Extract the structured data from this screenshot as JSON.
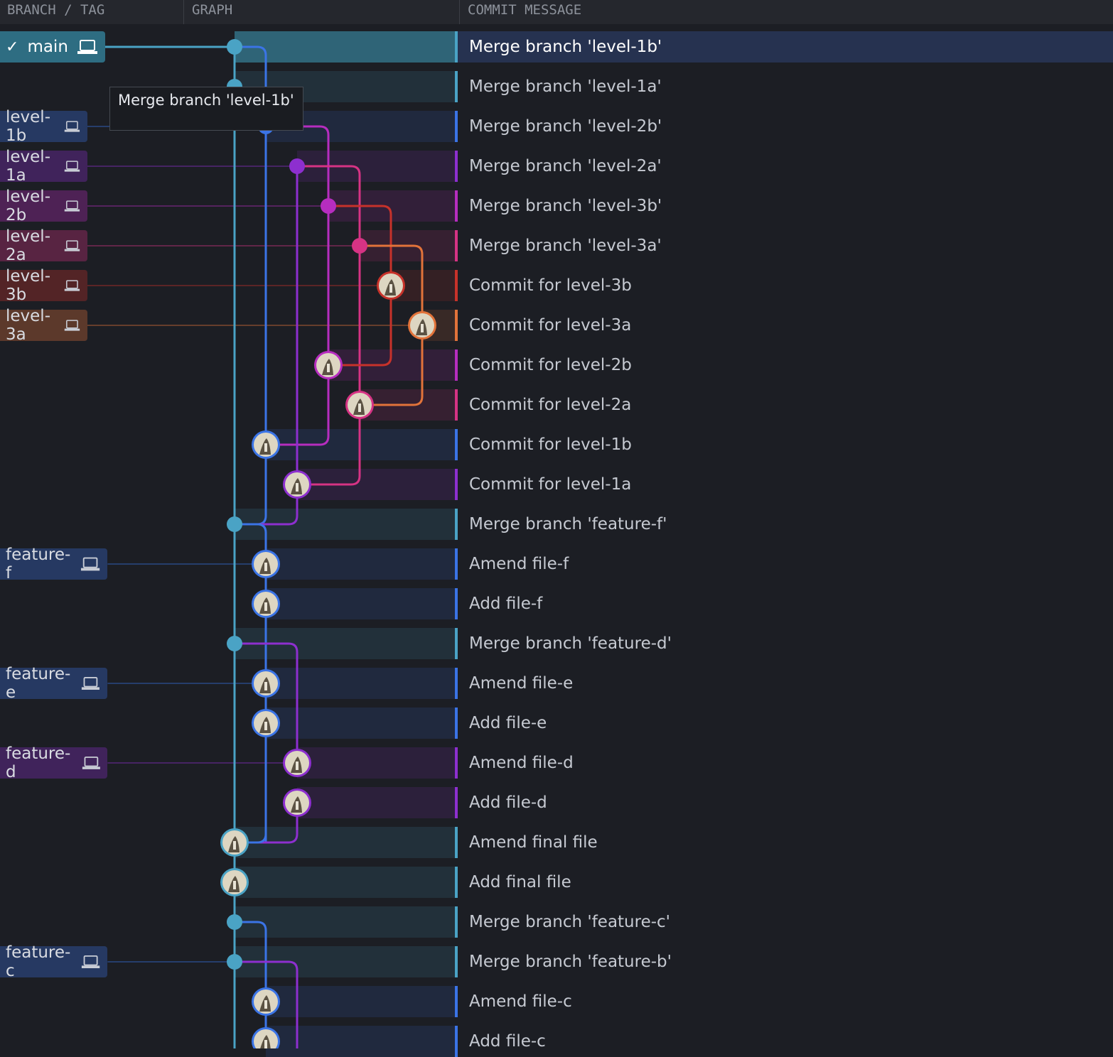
{
  "header": {
    "branch_tag": "BRANCH / TAG",
    "graph": "GRAPH",
    "commit_message": "COMMIT MESSAGE"
  },
  "tooltip": "Merge branch 'level-1b'",
  "colors": {
    "main": "#4aa3c5",
    "blue": "#3b74e6",
    "purple": "#8d2fcf",
    "magenta": "#b62dbf",
    "pink": "#d63384",
    "red": "#c7322a",
    "orange": "#e2733a"
  },
  "branches": [
    {
      "name": "main",
      "row": 0,
      "current": true,
      "color": "main",
      "icon": "laptop-icon"
    },
    {
      "name": "level-1b",
      "row": 2,
      "color": "blue",
      "icon": "laptop-icon"
    },
    {
      "name": "level-1a",
      "row": 3,
      "color": "purple",
      "icon": "laptop-icon"
    },
    {
      "name": "level-2b",
      "row": 4,
      "color": "magenta",
      "icon": "laptop-icon"
    },
    {
      "name": "level-2a",
      "row": 5,
      "color": "pink",
      "icon": "laptop-icon"
    },
    {
      "name": "level-3b",
      "row": 6,
      "color": "red",
      "icon": "laptop-icon"
    },
    {
      "name": "level-3a",
      "row": 7,
      "color": "orange",
      "icon": "laptop-icon"
    },
    {
      "name": "feature-f",
      "row": 13,
      "color": "blue",
      "icon": "laptop-icon"
    },
    {
      "name": "feature-e",
      "row": 16,
      "color": "blue",
      "icon": "laptop-icon"
    },
    {
      "name": "feature-d",
      "row": 18,
      "color": "purple",
      "icon": "laptop-icon"
    },
    {
      "name": "feature-c",
      "row": 23,
      "color": "blue",
      "icon": "laptop-icon"
    }
  ],
  "commits": [
    {
      "message": "Merge branch 'level-1b'",
      "lane": 0,
      "color": "main",
      "merge": true,
      "selected": true
    },
    {
      "message": "Merge branch 'level-1a'",
      "lane": 0,
      "color": "main",
      "merge": true
    },
    {
      "message": "Merge branch 'level-2b'",
      "lane": 1,
      "color": "blue",
      "merge": true
    },
    {
      "message": "Merge branch 'level-2a'",
      "lane": 2,
      "color": "purple",
      "merge": true
    },
    {
      "message": "Merge branch 'level-3b'",
      "lane": 3,
      "color": "magenta",
      "merge": true
    },
    {
      "message": "Merge branch 'level-3a'",
      "lane": 4,
      "color": "pink",
      "merge": true
    },
    {
      "message": "Commit for level-3b",
      "lane": 5,
      "color": "red",
      "merge": false
    },
    {
      "message": "Commit for level-3a",
      "lane": 6,
      "color": "orange",
      "merge": false
    },
    {
      "message": "Commit for level-2b",
      "lane": 3,
      "color": "magenta",
      "merge": false
    },
    {
      "message": "Commit for level-2a",
      "lane": 4,
      "color": "pink",
      "merge": false
    },
    {
      "message": "Commit for level-1b",
      "lane": 1,
      "color": "blue",
      "merge": false
    },
    {
      "message": "Commit for level-1a",
      "lane": 2,
      "color": "purple",
      "merge": false
    },
    {
      "message": "Merge branch 'feature-f'",
      "lane": 0,
      "color": "main",
      "merge": true
    },
    {
      "message": "Amend file-f",
      "lane": 1,
      "color": "blue",
      "merge": false
    },
    {
      "message": "Add file-f",
      "lane": 1,
      "color": "blue",
      "merge": false
    },
    {
      "message": "Merge branch 'feature-d'",
      "lane": 0,
      "color": "main",
      "merge": true
    },
    {
      "message": "Amend file-e",
      "lane": 1,
      "color": "blue",
      "merge": false
    },
    {
      "message": "Add file-e",
      "lane": 1,
      "color": "blue",
      "merge": false
    },
    {
      "message": "Amend file-d",
      "lane": 2,
      "color": "purple",
      "merge": false
    },
    {
      "message": "Add file-d",
      "lane": 2,
      "color": "purple",
      "merge": false
    },
    {
      "message": "Amend final file",
      "lane": 0,
      "color": "main",
      "merge": false
    },
    {
      "message": "Add final file",
      "lane": 0,
      "color": "main",
      "merge": false
    },
    {
      "message": "Merge branch 'feature-c'",
      "lane": 0,
      "color": "main",
      "merge": true
    },
    {
      "message": "Merge branch 'feature-b'",
      "lane": 0,
      "color": "main",
      "merge": true
    },
    {
      "message": "Amend file-c",
      "lane": 1,
      "color": "blue",
      "merge": false
    },
    {
      "message": "Add file-c",
      "lane": 1,
      "color": "blue",
      "merge": false
    }
  ],
  "edges": [
    {
      "type": "straight",
      "lane": 0,
      "from": 0,
      "to": 26,
      "color": "main"
    },
    {
      "type": "branch",
      "from": 0,
      "fromLane": 0,
      "toLane": 1,
      "to": 2,
      "color": "blue"
    },
    {
      "type": "straight",
      "lane": 1,
      "from": 2,
      "to": 10,
      "color": "blue"
    },
    {
      "type": "branch",
      "from": 2,
      "fromLane": 1,
      "toLane": 3,
      "to": 8,
      "color": "magenta"
    },
    {
      "type": "branch",
      "from": 3,
      "fromLane": 2,
      "toLane": 4,
      "to": 9,
      "color": "pink"
    },
    {
      "type": "branch",
      "from": 4,
      "fromLane": 3,
      "toLane": 5,
      "to": 6,
      "color": "red"
    },
    {
      "type": "branch",
      "from": 5,
      "fromLane": 4,
      "toLane": 6,
      "to": 7,
      "color": "orange"
    },
    {
      "type": "join",
      "from": 6,
      "fromLane": 5,
      "toLane": 3,
      "to": 8,
      "color": "red"
    },
    {
      "type": "join",
      "from": 7,
      "fromLane": 6,
      "toLane": 4,
      "to": 9,
      "color": "orange"
    },
    {
      "type": "join",
      "from": 8,
      "fromLane": 3,
      "toLane": 1,
      "to": 10,
      "color": "magenta"
    },
    {
      "type": "join",
      "from": 9,
      "fromLane": 4,
      "toLane": 2,
      "to": 11,
      "color": "pink"
    },
    {
      "type": "straight",
      "lane": 2,
      "from": 3,
      "to": 11,
      "color": "purple"
    },
    {
      "type": "join",
      "from": 10,
      "fromLane": 1,
      "toLane": 0,
      "to": 12,
      "color": "blue"
    },
    {
      "type": "join",
      "from": 11,
      "fromLane": 2,
      "toLane": 0,
      "to": 12,
      "color": "purple"
    },
    {
      "type": "branch",
      "from": 12,
      "fromLane": 0,
      "toLane": 1,
      "to": 13,
      "color": "blue"
    },
    {
      "type": "straight",
      "lane": 1,
      "from": 13,
      "to": 20,
      "color": "blue"
    },
    {
      "type": "branch",
      "from": 15,
      "fromLane": 0,
      "toLane": 2,
      "to": 18,
      "color": "purple"
    },
    {
      "type": "join",
      "from": 19,
      "fromLane": 2,
      "toLane": 0,
      "to": 20,
      "color": "purple"
    },
    {
      "type": "join",
      "from": 19,
      "fromLane": 1,
      "toLane": 0,
      "to": 20,
      "color": "blue"
    },
    {
      "type": "branch",
      "from": 22,
      "fromLane": 0,
      "toLane": 1,
      "to": 24,
      "color": "blue"
    },
    {
      "type": "straight",
      "lane": 1,
      "from": 24,
      "to": 26,
      "color": "blue"
    },
    {
      "type": "branch",
      "from": 23,
      "fromLane": 0,
      "toLane": 2,
      "to": 26,
      "color": "purple"
    }
  ]
}
